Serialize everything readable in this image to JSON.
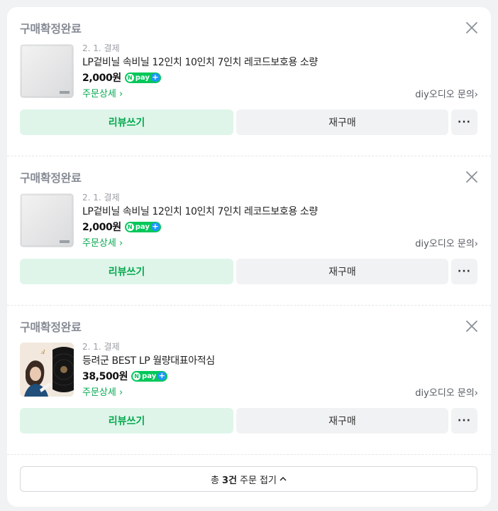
{
  "orders": [
    {
      "status": "구매확정완료",
      "date": "2. 1. 결제",
      "product_name": "LP겉비닐 속비닐 12인치 10인치 7인치 레코드보호용 소량",
      "price": "2,000원",
      "detail_link": "주문상세",
      "seller_link": "diy오디오 문의",
      "review_label": "리뷰쓰기",
      "rebuy_label": "재구매",
      "more_label": "···",
      "thumb": "lp-sleeve"
    },
    {
      "status": "구매확정완료",
      "date": "2. 1. 결제",
      "product_name": "LP겉비닐 속비닐 12인치 10인치 7인치 레코드보호용 소량",
      "price": "2,000원",
      "detail_link": "주문상세",
      "seller_link": "diy오디오 문의",
      "review_label": "리뷰쓰기",
      "rebuy_label": "재구매",
      "more_label": "···",
      "thumb": "lp-sleeve"
    },
    {
      "status": "구매확정완료",
      "date": "2. 1. 결제",
      "product_name": "등려군 BEST LP 월량대표아적심",
      "price": "38,500원",
      "detail_link": "주문상세",
      "seller_link": "diy오디오 문의",
      "review_label": "리뷰쓰기",
      "rebuy_label": "재구매",
      "more_label": "···",
      "thumb": "album-cover"
    }
  ],
  "npay": {
    "label": "pay",
    "n": "N",
    "plus": "+"
  },
  "fold": {
    "prefix": "총",
    "count": "3건",
    "suffix": "주문 접기"
  },
  "colors": {
    "accent_green": "#03c75a",
    "review_bg": "#dff5ea",
    "npay_plus": "#1e96ff"
  }
}
